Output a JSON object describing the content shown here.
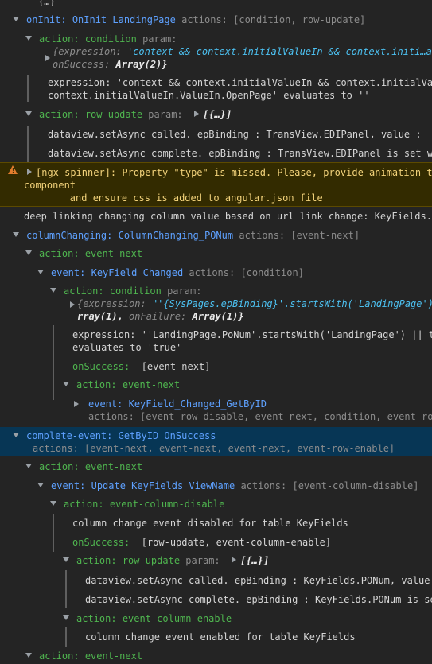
{
  "rows": {
    "r0": "{…}",
    "r1_name": "onInit:",
    "r1_val": "OnInit_LandingPage",
    "r1_actions": "actions: [condition, row-update]",
    "r2_kind": "action:",
    "r2_val": "condition",
    "r2_param": "param:",
    "r3_obj_a": "{expression:",
    "r3_obj_b": "'context && context.initialValueIn && context.initi…ar",
    "r4_onsuccess": "onSuccess:",
    "r4_val": "Array(2)}",
    "r5_text": "expression: 'context && context.initialValueIn && context.initialValueIn",
    "r6_text": "context.initialValueIn.ValueIn.OpenPage' evaluates to ''",
    "r7_kind": "action:",
    "r7_val": "row-update",
    "r7_param": "param:",
    "r7_obj": "[{…}]",
    "r8_text": "dataview.setAsync called. epBinding : TransView.EDIPanel, value :",
    "r9_text": "dataview.setAsync complete. epBinding : TransView.EDIPanel is set w",
    "warn1": "[ngx-spinner]: Property \"type\" is missed. Please, provide animation t",
    "warn2": "component",
    "warn3": "        and ensure css is added to angular.json file",
    "r13_text": "deep linking changing column value based on url link change: KeyFields.",
    "r14_name": "columnChanging:",
    "r14_val": "ColumnChanging_PONum",
    "r14_actions": "actions: [event-next]",
    "r15_kind": "action:",
    "r15_val": "event-next",
    "r16_name": "event:",
    "r16_val": "KeyField_Changed",
    "r16_actions": "actions: [condition]",
    "r17_kind": "action:",
    "r17_val": "condition",
    "r17_param": "param:",
    "r18_a": "{expression:",
    "r18_b": "\"'{SysPages.epBinding}'.startsWith('LandingPage')",
    "r19_a": "rray(1),",
    "r19_b": "onFailure:",
    "r19_c": "Array(1)}",
    "r20_text": "expression: ''LandingPage.PoNum'.startsWith('LandingPage') || t",
    "r21_text": "evaluates to 'true'",
    "r22_onsuccess": "onSuccess:",
    "r22_val": "[event-next]",
    "r23_kind": "action:",
    "r23_val": "event-next",
    "r24_name": "event:",
    "r24_val": "KeyField_Changed_GetByID",
    "r25_actions": "actions: [event-row-disable, event-next, condition, event-ro",
    "r26_name": "complete-event:",
    "r26_val": "GetByID_OnSuccess",
    "r27_actions": "actions: [event-next, event-next, event-next, event-row-enable]",
    "r28_kind": "action:",
    "r28_val": "event-next",
    "r29_name": "event:",
    "r29_val": "Update_KeyFields_ViewName",
    "r29_actions": "actions: [event-column-disable]",
    "r30_kind": "action:",
    "r30_val": "event-column-disable",
    "r31_text": "column change event disabled for table KeyFields",
    "r32_onsuccess": "onSuccess:",
    "r32_val": "[row-update, event-column-enable]",
    "r33_kind": "action:",
    "r33_val": "row-update",
    "r33_param": "param:",
    "r33_obj": "[{…}]",
    "r34_text": "dataview.setAsync called. epBinding : KeyFields.PONum, value",
    "r35_text": "dataview.setAsync complete. epBinding : KeyFields.PONum is se",
    "r36_kind": "action:",
    "r36_val": "event-column-enable",
    "r37_text": "column change event enabled for table KeyFields",
    "r38_kind": "action:",
    "r38_val": "event-next"
  },
  "icons": {
    "warning": "warning-icon"
  },
  "colors": {
    "background": "#242424",
    "selection": "#073655",
    "warning_bg": "#332b00"
  }
}
